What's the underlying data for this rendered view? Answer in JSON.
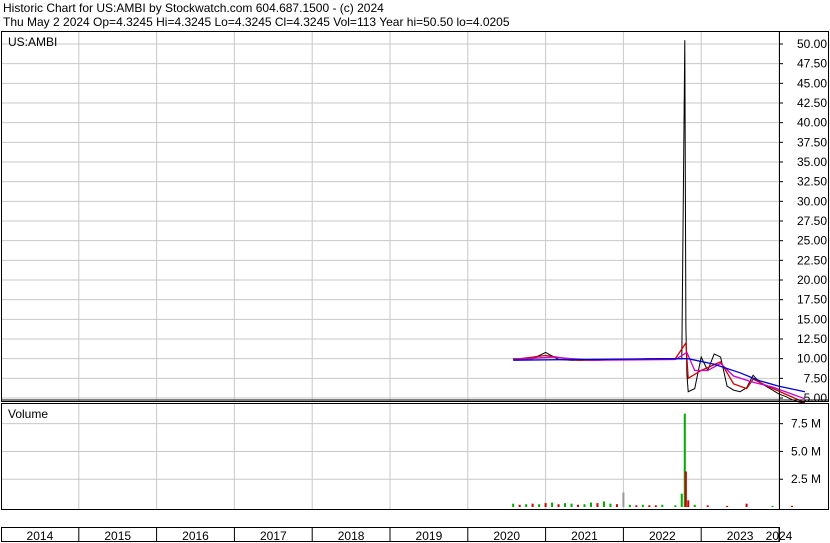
{
  "header": {
    "line1": "Historic Chart for US:AMBI by Stockwatch.com 604.687.1500 - (c) 2024",
    "line2": "Thu May  2 2024   Op=4.3245   Hi=4.3245   Lo=4.3245   Cl=4.3245   Vol=113   Year hi=50.50   lo=4.0205"
  },
  "colors": {
    "price": "#000000",
    "short_ma": "#cc0000",
    "mid_ma": "#cc00cc",
    "long_ma": "#0000cc",
    "volume_up": "#00aa00",
    "volume_down": "#cc0000",
    "volume_other": "#999999",
    "grid": "#c8c8c8"
  },
  "chart_data": [
    {
      "type": "line",
      "title": "US:AMBI",
      "ylim": [
        3,
        52
      ],
      "y_ticks": [
        "5.00",
        "7.50",
        "10.00",
        "12.50",
        "15.00",
        "17.50",
        "20.00",
        "22.50",
        "25.00",
        "27.50",
        "30.00",
        "32.50",
        "35.00",
        "37.50",
        "40.00",
        "42.50",
        "45.00",
        "47.50",
        "50.00"
      ],
      "x_labels": [
        "2014",
        "2015",
        "2016",
        "2017",
        "2018",
        "2019",
        "2020",
        "2021",
        "2022",
        "2023",
        "2024"
      ],
      "series": [
        {
          "key": "price",
          "x": [
            "2020-08",
            "2020-11",
            "2021-01",
            "2021-03",
            "2021-05",
            "2021-09",
            "2022-01",
            "2022-05",
            "2022-09",
            "2022-10",
            "2022-10-15",
            "2022-10-20",
            "2022-10-25",
            "2022-11",
            "2022-12",
            "2023-01",
            "2023-02",
            "2023-03",
            "2023-04",
            "2023-05",
            "2023-06",
            "2023-07",
            "2023-08",
            "2023-09",
            "2023-10",
            "2023-11",
            "2023-12",
            "2024-01",
            "2024-02",
            "2024-03",
            "2024-04",
            "2024-05"
          ],
          "values": [
            10.0,
            10.0,
            10.8,
            9.9,
            9.8,
            9.8,
            9.9,
            10.0,
            10.0,
            10.0,
            50.5,
            14.0,
            8.0,
            5.8,
            6.2,
            10.2,
            8.5,
            10.6,
            10.2,
            6.5,
            6.0,
            5.8,
            6.3,
            7.9,
            7.0,
            6.5,
            6.0,
            5.5,
            5.2,
            4.8,
            4.5,
            4.3245
          ]
        },
        {
          "key": "short_ma",
          "x": [
            "2020-08",
            "2021-01",
            "2021-06",
            "2022-01",
            "2022-09",
            "2022-10-20",
            "2022-11",
            "2023-01",
            "2023-04",
            "2023-06",
            "2023-08",
            "2023-09",
            "2023-11",
            "2024-02",
            "2024-05"
          ],
          "values": [
            9.9,
            10.4,
            9.8,
            9.9,
            10.0,
            12.0,
            7.5,
            8.5,
            9.6,
            6.8,
            6.2,
            7.4,
            6.6,
            5.5,
            4.4
          ]
        },
        {
          "key": "mid_ma",
          "x": [
            "2020-08",
            "2021-02",
            "2021-08",
            "2022-09",
            "2022-10-25",
            "2022-12",
            "2023-02",
            "2023-04",
            "2023-06",
            "2023-09",
            "2023-12",
            "2024-03",
            "2024-05"
          ],
          "values": [
            9.9,
            10.2,
            9.8,
            9.9,
            10.8,
            8.5,
            8.5,
            9.4,
            7.8,
            7.0,
            6.4,
            5.5,
            4.9
          ]
        },
        {
          "key": "long_ma",
          "x": [
            "2020-08",
            "2021-06",
            "2022-09",
            "2022-11",
            "2023-03",
            "2023-07",
            "2023-10",
            "2024-01",
            "2024-05"
          ],
          "values": [
            9.8,
            9.9,
            10.0,
            10.0,
            9.3,
            8.2,
            7.2,
            6.5,
            5.8
          ]
        }
      ]
    },
    {
      "type": "bar",
      "title": "Volume",
      "ylim": [
        0,
        9000000
      ],
      "y_ticks": [
        "2.5 M",
        "5.0 M",
        "7.5 M"
      ],
      "y_tick_values": [
        2500000,
        5000000,
        7500000
      ],
      "bars": [
        {
          "x": "2020-08",
          "value": 300000,
          "dir": "up"
        },
        {
          "x": "2020-09",
          "value": 200000,
          "dir": "down"
        },
        {
          "x": "2020-10",
          "value": 250000,
          "dir": "up"
        },
        {
          "x": "2020-11",
          "value": 300000,
          "dir": "down"
        },
        {
          "x": "2020-12",
          "value": 250000,
          "dir": "up"
        },
        {
          "x": "2021-01",
          "value": 350000,
          "dir": "down"
        },
        {
          "x": "2021-02",
          "value": 400000,
          "dir": "up"
        },
        {
          "x": "2021-03",
          "value": 250000,
          "dir": "down"
        },
        {
          "x": "2021-04",
          "value": 350000,
          "dir": "up"
        },
        {
          "x": "2021-05",
          "value": 300000,
          "dir": "up"
        },
        {
          "x": "2021-06",
          "value": 200000,
          "dir": "down"
        },
        {
          "x": "2021-07",
          "value": 250000,
          "dir": "up"
        },
        {
          "x": "2021-08",
          "value": 400000,
          "dir": "up"
        },
        {
          "x": "2021-09",
          "value": 350000,
          "dir": "down"
        },
        {
          "x": "2021-10",
          "value": 500000,
          "dir": "up"
        },
        {
          "x": "2021-11",
          "value": 300000,
          "dir": "up"
        },
        {
          "x": "2021-12",
          "value": 250000,
          "dir": "down"
        },
        {
          "x": "2022-01",
          "value": 1300000,
          "dir": "other"
        },
        {
          "x": "2022-02",
          "value": 200000,
          "dir": "up"
        },
        {
          "x": "2022-03",
          "value": 150000,
          "dir": "down"
        },
        {
          "x": "2022-04",
          "value": 200000,
          "dir": "up"
        },
        {
          "x": "2022-05",
          "value": 150000,
          "dir": "down"
        },
        {
          "x": "2022-06",
          "value": 150000,
          "dir": "down"
        },
        {
          "x": "2022-07",
          "value": 200000,
          "dir": "up"
        },
        {
          "x": "2022-09",
          "value": 150000,
          "dir": "up"
        },
        {
          "x": "2022-10",
          "value": 1200000,
          "dir": "up"
        },
        {
          "x": "2022-10-15",
          "value": 8400000,
          "dir": "up"
        },
        {
          "x": "2022-10-20",
          "value": 3200000,
          "dir": "down"
        },
        {
          "x": "2022-11",
          "value": 600000,
          "dir": "down"
        },
        {
          "x": "2022-12",
          "value": 200000,
          "dir": "up"
        },
        {
          "x": "2023-02",
          "value": 150000,
          "dir": "down"
        },
        {
          "x": "2023-05",
          "value": 100000,
          "dir": "down"
        },
        {
          "x": "2023-08",
          "value": 300000,
          "dir": "down"
        },
        {
          "x": "2023-12",
          "value": 100000,
          "dir": "up"
        },
        {
          "x": "2024-03",
          "value": 100000,
          "dir": "down"
        }
      ]
    }
  ]
}
